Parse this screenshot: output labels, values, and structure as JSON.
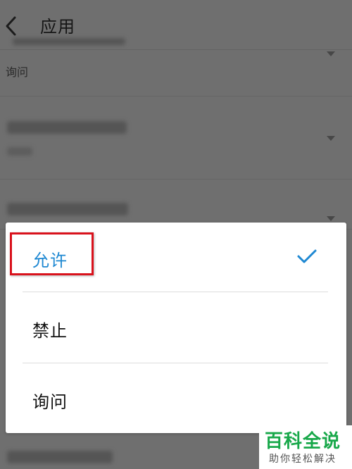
{
  "header": {
    "title": "应用"
  },
  "background_rows": [
    {
      "subtitle": "询问"
    }
  ],
  "dialog": {
    "options": [
      {
        "label": "允许",
        "selected": true
      },
      {
        "label": "禁止",
        "selected": false
      },
      {
        "label": "询问",
        "selected": false
      }
    ],
    "accent_color": "#1e88d2",
    "highlight_color": "#d9121c"
  },
  "watermark": {
    "title": "百科全说",
    "subtitle": "助你轻松解决"
  }
}
